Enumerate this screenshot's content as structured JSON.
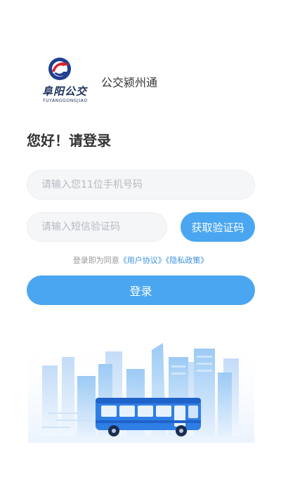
{
  "brand": {
    "logo_text": "阜阳公交",
    "logo_subtext": "FUYANGGONGJIAO",
    "app_name": "公交颍州通"
  },
  "greeting": "您好！请登录",
  "form": {
    "phone_placeholder": "请输入您11位手机号码",
    "code_placeholder": "请输入短信验证码",
    "get_code_label": "获取验证码",
    "agreement_prefix": "登录即为同意",
    "user_agreement": "《用户协议》",
    "privacy_policy": "《隐私政策》",
    "login_label": "登录"
  },
  "colors": {
    "primary": "#4aa6f0",
    "link": "#3b8fe0",
    "input_bg": "#f5f6f8"
  },
  "icons": {
    "logo": "fuyang-bus-logo-icon",
    "illustration": "city-bus-illustration"
  }
}
